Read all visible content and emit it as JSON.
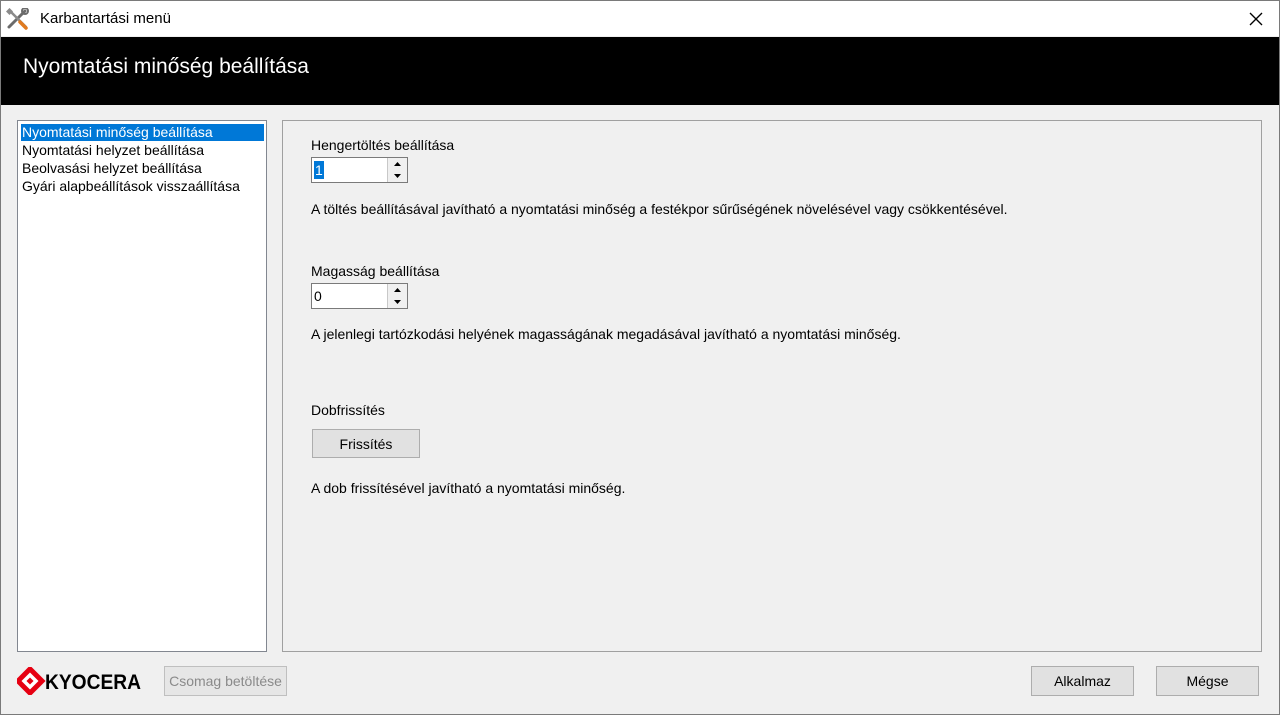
{
  "window": {
    "title": "Karbantartási menü",
    "app_icon": "tools-icon",
    "close_icon": "close-icon"
  },
  "header": {
    "title": "Nyomtatási minőség beállítása"
  },
  "nav": {
    "items": [
      {
        "label": "Nyomtatási minőség beállítása",
        "selected": true
      },
      {
        "label": "Nyomtatási helyzet beállítása",
        "selected": false
      },
      {
        "label": "Beolvasási helyzet beállítása",
        "selected": false
      },
      {
        "label": "Gyári alapbeállítások visszaállítása",
        "selected": false
      }
    ]
  },
  "panel": {
    "roller": {
      "label": "Hengertöltés beállítása",
      "value": "1",
      "description": "A töltés beállításával javítható a nyomtatási minőség a festékpor sűrűségének növelésével vagy csökkentésével."
    },
    "altitude": {
      "label": "Magasság beállítása",
      "value": "0",
      "description": "A jelenlegi tartózkodási helyének magasságának megadásával javítható a nyomtatási minőség."
    },
    "drum": {
      "label": "Dobfrissítés",
      "button": "Frissítés",
      "description": "A dob frissítésével javítható a nyomtatási minőség."
    }
  },
  "footer": {
    "logo_text": "KYOCERA",
    "load_package_label": "Csomag betöltése",
    "apply_label": "Alkalmaz",
    "cancel_label": "Mégse"
  },
  "colors": {
    "selection": "#0078d7",
    "brand_red": "#e60012",
    "header_bg": "#000000"
  }
}
